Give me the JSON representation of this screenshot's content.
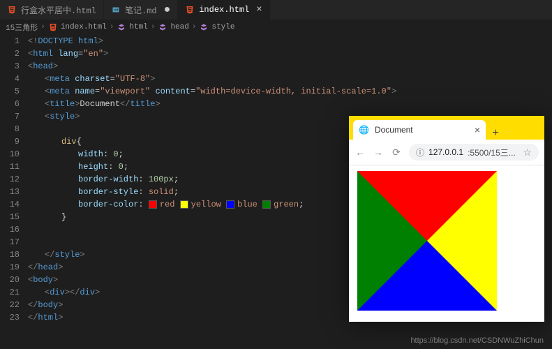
{
  "tabs": [
    {
      "label": "行盒水平居中.html",
      "modified": false
    },
    {
      "label": "笔记.md",
      "modified": true
    },
    {
      "label": "index.html",
      "modified": false,
      "active": true
    }
  ],
  "breadcrumb": {
    "items": [
      "15三角形",
      "index.html",
      "html",
      "head",
      "style"
    ]
  },
  "editor": {
    "lines": {
      "count": 23,
      "l1_doctype": "DOCTYPE html",
      "l2_lang": "en",
      "l4_charset": "UTF-8",
      "l5_name": "viewport",
      "l5_content": "width=device-width, initial-scale=1.0",
      "l6_title": "Document",
      "l9_selector": "div",
      "l10_prop": "width",
      "l10_val": "0",
      "l11_prop": "height",
      "l11_val": "0",
      "l12_prop": "border-width",
      "l12_val": "100px",
      "l13_prop": "border-style",
      "l13_val": "solid",
      "l14_prop": "border-color",
      "l14_colors": [
        "red",
        "yellow",
        "blue",
        "green"
      ]
    }
  },
  "browser": {
    "tab_title": "Document",
    "url_host": "127.0.0.1",
    "url_port_path": ":5500/15三..."
  },
  "watermark": "https://blog.csdn.net/CSDNWuZhiChun"
}
